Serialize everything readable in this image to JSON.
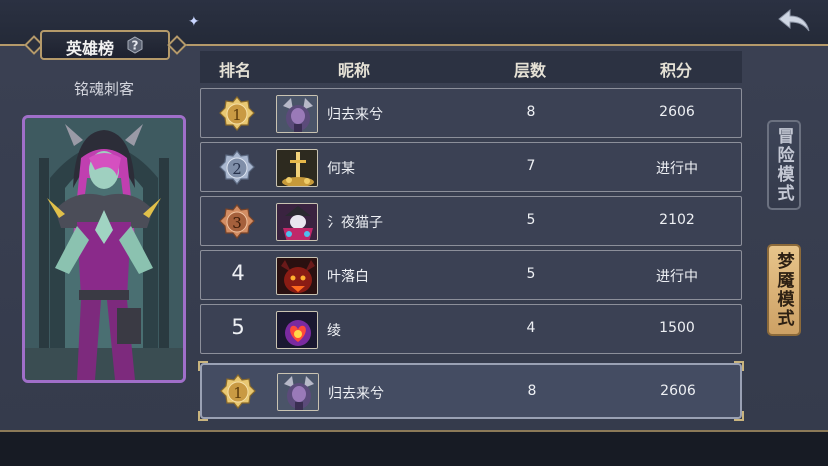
{
  "title": "英雄榜",
  "character_name": "铭魂刺客",
  "headers": {
    "rank": "排名",
    "nickname": "昵称",
    "floors": "层数",
    "score": "积分"
  },
  "rows": [
    {
      "rank": "1",
      "nickname": "归去来兮",
      "floors": "8",
      "score": "2606",
      "badge": "gold"
    },
    {
      "rank": "2",
      "nickname": "何某",
      "floors": "7",
      "score": "进行中",
      "badge": "silver"
    },
    {
      "rank": "3",
      "nickname": "氵夜猫子",
      "floors": "5",
      "score": "2102",
      "badge": "bronze"
    },
    {
      "rank": "4",
      "nickname": "叶落白",
      "floors": "5",
      "score": "进行中",
      "badge": "none"
    },
    {
      "rank": "5",
      "nickname": "绫",
      "floors": "4",
      "score": "1500",
      "badge": "none"
    }
  ],
  "my_row": {
    "rank": "1",
    "nickname": "归去来兮",
    "floors": "8",
    "score": "2606",
    "badge": "gold"
  },
  "modes": {
    "adventure": "冒险模式",
    "nightmare": "梦魇模式",
    "active": "nightmare"
  },
  "icons": {
    "back": "back-arrow-icon",
    "help": "question-icon"
  },
  "colors": {
    "gold": "#d8b46a",
    "silver": "#9aa8c2",
    "bronze": "#c07a55",
    "portrait_border": "#a06fc9",
    "frame": "#b59a6a"
  }
}
